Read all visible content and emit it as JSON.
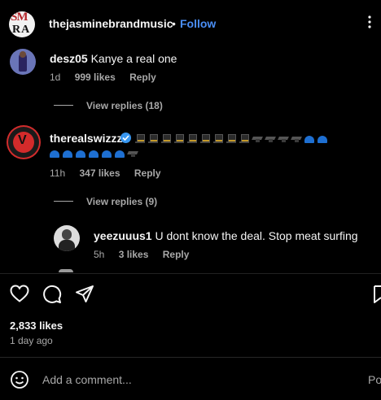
{
  "header": {
    "logo_text_top": "SM",
    "logo_text_bottom": "RA",
    "username": "thejasminebrandmusic",
    "separator": "•",
    "follow_label": "Follow",
    "more_icon": "more-dots-icon"
  },
  "comments": [
    {
      "username": "desz05",
      "text": "Kanye a real one",
      "time": "1d",
      "likes": "999 likes",
      "reply_label": "Reply",
      "view_replies": "View replies (18)"
    },
    {
      "username": "therealswizzz",
      "verified": true,
      "emoji_row1": [
        "top-hat",
        "top-hat",
        "top-hat",
        "top-hat",
        "top-hat",
        "top-hat",
        "top-hat",
        "top-hat",
        "top-hat",
        "graduation-cap",
        "graduation-cap",
        "graduation-cap",
        "graduation-cap",
        "blue-cap",
        "blue-cap"
      ],
      "emoji_row2": [
        "blue-cap",
        "blue-cap",
        "blue-cap",
        "blue-cap",
        "blue-cap",
        "blue-cap",
        "graduation-cap"
      ],
      "time": "11h",
      "likes": "347 likes",
      "reply_label": "Reply",
      "view_replies": "View replies (9)"
    }
  ],
  "reply": {
    "username": "yeezuuus1",
    "text": "U dont know the deal. Stop meat surfing",
    "time": "5h",
    "likes": "3 likes",
    "reply_label": "Reply"
  },
  "actions": {
    "icons": [
      "heart-icon",
      "comment-icon",
      "share-icon",
      "bookmark-icon"
    ]
  },
  "post": {
    "likes": "2,833 likes",
    "time": "1 day ago"
  },
  "composer": {
    "placeholder": "Add a comment...",
    "post_label": "Po"
  },
  "colors": {
    "background": "#000000",
    "accent": "#4a8ef5",
    "muted": "#a8a8a8",
    "verified": "#3897f0"
  }
}
